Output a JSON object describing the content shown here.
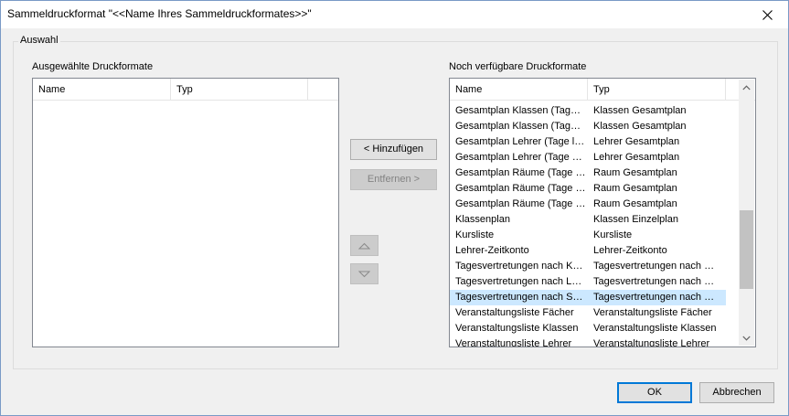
{
  "window": {
    "title": "Sammeldruckformat \"<<Name Ihres Sammeldruckformates>>\""
  },
  "group": {
    "legend": "Auswahl"
  },
  "selected_list": {
    "label": "Ausgewählte Druckformate",
    "columns": [
      "Name",
      "Typ"
    ],
    "rows": []
  },
  "available_list": {
    "label": "Noch verfügbare Druckformate",
    "columns": [
      "Name",
      "Typ"
    ],
    "selected_index": 12,
    "rows": [
      {
        "name": "Gesamtplan Klassen (Tage…",
        "type": "Klassen Gesamtplan"
      },
      {
        "name": "Gesamtplan Klassen (Tage…",
        "type": "Klassen Gesamtplan"
      },
      {
        "name": "Gesamtplan Lehrer (Tage li…",
        "type": "Lehrer Gesamtplan"
      },
      {
        "name": "Gesamtplan Lehrer (Tage …",
        "type": "Lehrer Gesamtplan"
      },
      {
        "name": "Gesamtplan Räume (Tage l…",
        "type": "Raum Gesamtplan"
      },
      {
        "name": "Gesamtplan Räume (Tage l…",
        "type": "Raum Gesamtplan"
      },
      {
        "name": "Gesamtplan Räume (Tage …",
        "type": "Raum Gesamtplan"
      },
      {
        "name": "Klassenplan",
        "type": "Klassen Einzelplan"
      },
      {
        "name": "Kursliste",
        "type": "Kursliste"
      },
      {
        "name": "Lehrer-Zeitkonto",
        "type": "Lehrer-Zeitkonto"
      },
      {
        "name": "Tagesvertretungen nach K…",
        "type": "Tagesvertretungen nach …"
      },
      {
        "name": "Tagesvertretungen nach L…",
        "type": "Tagesvertretungen nach …"
      },
      {
        "name": "Tagesvertretungen nach S…",
        "type": "Tagesvertretungen nach …"
      },
      {
        "name": "Veranstaltungsliste Fächer",
        "type": "Veranstaltungsliste Fächer"
      },
      {
        "name": "Veranstaltungsliste Klassen",
        "type": "Veranstaltungsliste Klassen"
      },
      {
        "name": "Veranstaltungsliste Lehrer",
        "type": "Veranstaltungsliste Lehrer"
      }
    ]
  },
  "buttons": {
    "add": "< Hinzufügen",
    "remove": "Entfernen >",
    "ok": "OK",
    "cancel": "Abbrechen"
  },
  "icons": {
    "close": "close-icon",
    "move_up": "triangle-up-icon",
    "move_down": "triangle-down-icon",
    "scroll_up": "chevron-up-icon",
    "scroll_down": "chevron-down-icon"
  },
  "colors": {
    "selection": "#cce8ff",
    "default_button_border": "#0078d7"
  }
}
